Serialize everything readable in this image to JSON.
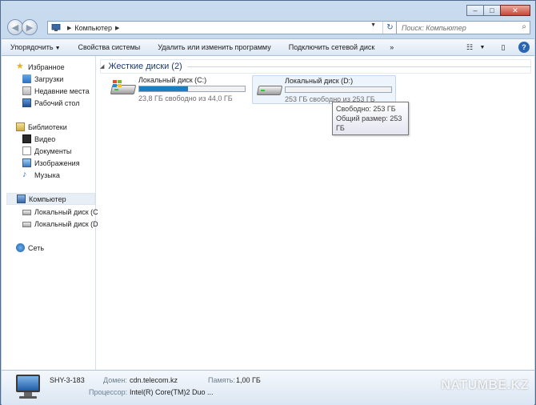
{
  "window": {
    "controls": {
      "minimize": "–",
      "maximize": "□",
      "close": "✕"
    }
  },
  "nav": {
    "back_glyph": "◀",
    "forward_glyph": "▶",
    "address": {
      "crumbs": [
        "Компьютер"
      ],
      "dropdown_glyph": "▼",
      "refresh_glyph": "↻"
    },
    "search": {
      "placeholder": "Поиск: Компьютер",
      "glyph": "⌕"
    }
  },
  "toolbar": {
    "organize": "Упорядочить",
    "dropdown_glyph": "▼",
    "system_props": "Свойства системы",
    "uninstall": "Удалить или изменить программу",
    "map_drive": "Подключить сетевой диск",
    "more": "»",
    "view_glyph": "☷",
    "pane_glyph": "▯",
    "help_glyph": "?"
  },
  "sidebar": {
    "favorites": {
      "label": "Избранное",
      "items": [
        "Загрузки",
        "Недавние места",
        "Рабочий стол"
      ]
    },
    "libraries": {
      "label": "Библиотеки",
      "items": [
        "Видео",
        "Документы",
        "Изображения",
        "Музыка"
      ]
    },
    "computer": {
      "label": "Компьютер",
      "items": [
        "Локальный диск (C",
        "Локальный диск (D"
      ]
    },
    "network": {
      "label": "Сеть"
    }
  },
  "content": {
    "group": {
      "caret": "◢",
      "title": "Жесткие диски (2)"
    },
    "drives": [
      {
        "name": "Локальный диск (C:)",
        "free_text": "23,8 ГБ свободно из 44,0 ГБ",
        "used_fraction": 0.46,
        "fill_color": "#1a7fc1"
      },
      {
        "name": "Локальный диск (D:)",
        "free_text": "253 ГБ свободно из 253 ГБ",
        "used_fraction": 0.0,
        "fill_color": "#1a7fc1"
      }
    ],
    "tooltip": {
      "line1": "Свободно: 253 ГБ",
      "line2": "Общий размер: 253 ГБ"
    }
  },
  "details": {
    "name": "SHY-3-183",
    "domain_label": "Домен:",
    "domain_value": "cdn.telecom.kz",
    "memory_label": "Память:",
    "memory_value": "1,00 ГБ",
    "cpu_label": "Процессор:",
    "cpu_value": "Intel(R) Core(TM)2 Duo ..."
  },
  "watermark": "NATUMBE.KZ"
}
